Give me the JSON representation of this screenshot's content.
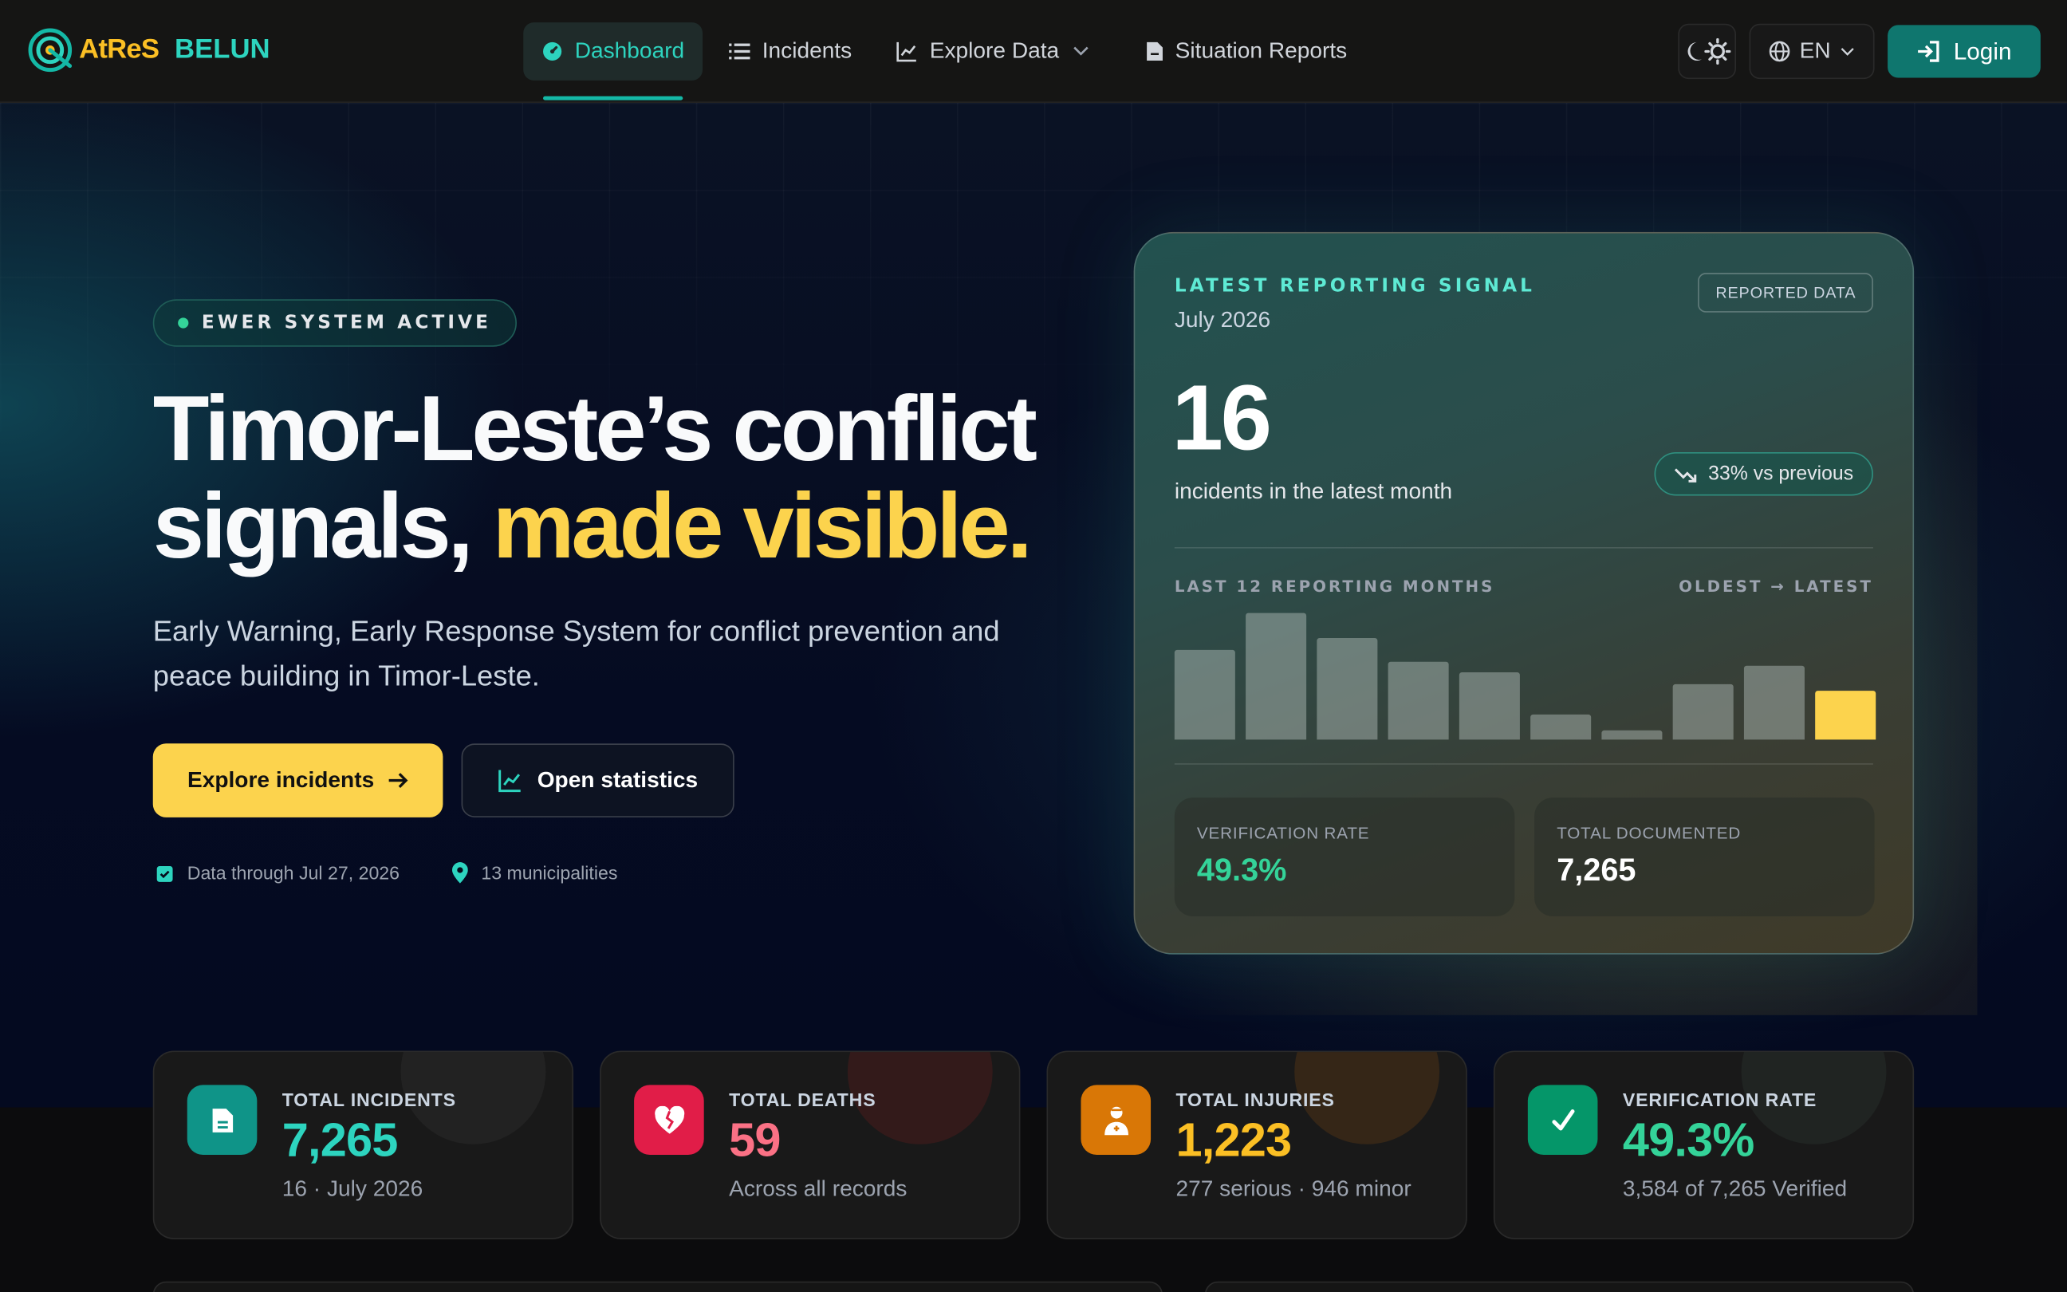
{
  "brand": {
    "name_primary": "AtReS",
    "name_secondary": "BELUN"
  },
  "nav": {
    "items": [
      {
        "label": "Dashboard",
        "icon": "gauge-icon",
        "active": true
      },
      {
        "label": "Incidents",
        "icon": "list-icon"
      },
      {
        "label": "Explore Data",
        "icon": "line-chart-icon",
        "dropdown": true
      },
      {
        "label": "Situation Reports",
        "icon": "document-icon"
      }
    ],
    "language": "EN",
    "login_label": "Login"
  },
  "hero": {
    "badge": "EWER SYSTEM ACTIVE",
    "headline_line1": "Timor-Leste’s conflict",
    "headline_line2_plain": "signals, ",
    "headline_line2_highlight": "made visible.",
    "subheading": "Early Warning, Early Response System for conflict prevention and peace building in Timor-Leste.",
    "primary_cta": "Explore incidents",
    "secondary_cta": "Open statistics",
    "meta_date": "Data through Jul 27, 2026",
    "meta_places": "13 municipalities"
  },
  "signal": {
    "label": "LATEST REPORTING SIGNAL",
    "month": "July 2026",
    "tag": "REPORTED DATA",
    "value": "16",
    "caption": "incidents in the latest month",
    "change": "33% vs previous",
    "chart_label_left": "LAST 12 REPORTING MONTHS",
    "chart_label_right": "OLDEST → LATEST",
    "tiles": [
      {
        "label": "VERIFICATION RATE",
        "value": "49.3%",
        "color": "#34d399"
      },
      {
        "label": "TOTAL DOCUMENTED",
        "value": "7,265",
        "color": "#ffffff"
      }
    ]
  },
  "chart_data": {
    "type": "bar",
    "values": [
      29,
      41,
      33,
      25,
      22,
      8,
      3,
      18,
      24,
      16
    ],
    "highlight_last": true,
    "ylim": [
      0,
      41
    ]
  },
  "kpis": [
    {
      "label": "TOTAL INCIDENTS",
      "value": "7,265",
      "sub": "16 · July 2026",
      "color": "#2dd4bf",
      "icon_bg": "#0f9488",
      "icon": "document-icon",
      "blob": "rgba(80,80,80,0.18)"
    },
    {
      "label": "TOTAL DEATHS",
      "value": "59",
      "sub": "Across all records",
      "color": "#fb7185",
      "icon_bg": "#e11d48",
      "icon": "broken-heart-icon",
      "blob": "rgba(120,30,30,0.28)"
    },
    {
      "label": "TOTAL INJURIES",
      "value": "1,223",
      "sub": "277 serious · 946 minor",
      "color": "#fbbf24",
      "icon_bg": "#d97706",
      "icon": "injured-person-icon",
      "blob": "rgba(120,70,20,0.3)"
    },
    {
      "label": "VERIFICATION RATE",
      "value": "49.3%",
      "sub": "3,584 of 7,265 Verified",
      "color": "#34d399",
      "icon_bg": "#059669",
      "icon": "check-icon",
      "blob": "rgba(60,80,70,0.2)"
    }
  ]
}
